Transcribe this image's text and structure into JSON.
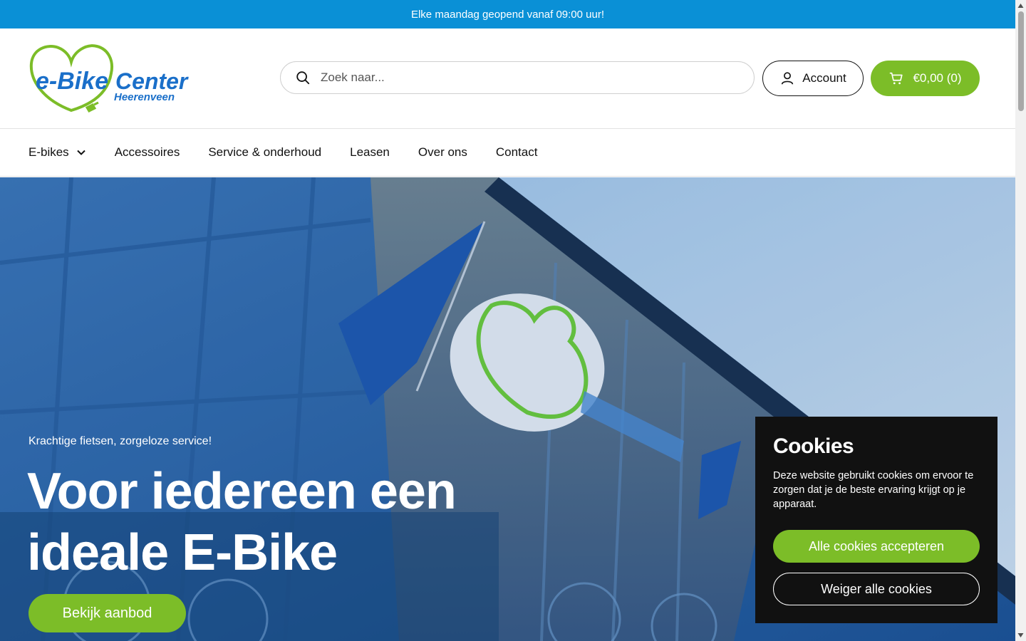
{
  "announcement": {
    "text": "Elke maandag geopend vanaf 09:00 uur!"
  },
  "brand": {
    "line1_a": "e-Bike",
    "line1_b": "Center",
    "line2": "Heerenveen",
    "green": "#7cbd28",
    "blue": "#1a6fc9"
  },
  "search": {
    "placeholder": "Zoek naar..."
  },
  "account": {
    "label": "Account"
  },
  "cart": {
    "label": "€0,00 (0)"
  },
  "nav": {
    "items": [
      {
        "label": "E-bikes",
        "has_dropdown": true
      },
      {
        "label": "Accessoires"
      },
      {
        "label": "Service & onderhoud"
      },
      {
        "label": "Leasen"
      },
      {
        "label": "Over ons"
      },
      {
        "label": "Contact"
      }
    ]
  },
  "hero": {
    "subtitle": "Krachtige fietsen, zorgeloze service!",
    "title": "Voor iedereen een ideale E-Bike",
    "cta_label": "Bekijk aanbod"
  },
  "cookies": {
    "title": "Cookies",
    "text": "Deze website gebruikt cookies om ervoor te zorgen dat je de beste ervaring krijgt op je apparaat.",
    "accept_label": "Alle cookies accepteren",
    "reject_label": "Weiger alle cookies"
  },
  "colors": {
    "announcement_bg": "#0a90d6",
    "accent": "#7cbd28",
    "cookie_bg": "#111111"
  }
}
